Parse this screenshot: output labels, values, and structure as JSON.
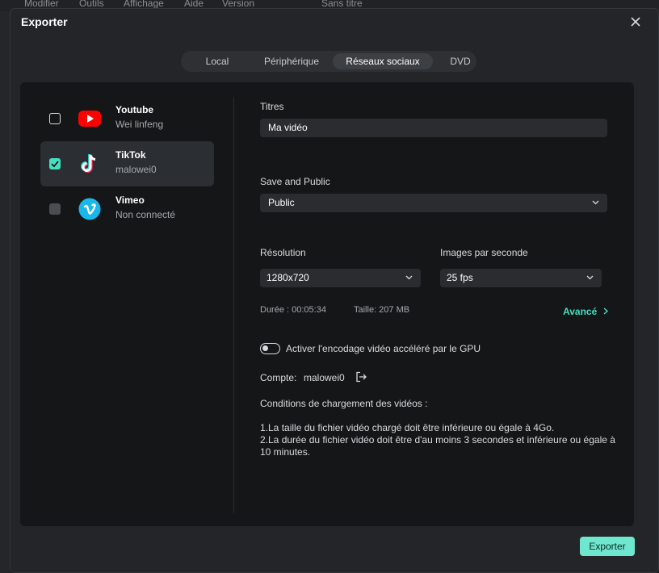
{
  "background_menu": [
    "Modifier",
    "Outils",
    "Affichage",
    "Aide",
    "Version",
    "Sans titre"
  ],
  "dialog": {
    "title": "Exporter"
  },
  "tabs": [
    {
      "label": "Local",
      "active": false
    },
    {
      "label": "Périphérique",
      "active": false
    },
    {
      "label": "Réseaux sociaux",
      "active": true
    },
    {
      "label": "DVD",
      "active": false
    }
  ],
  "accounts": [
    {
      "name": "Youtube",
      "subtitle": "Wei linfeng",
      "checked": false,
      "icon": "youtube-icon"
    },
    {
      "name": "TikTok",
      "subtitle": "malowei0",
      "checked": true,
      "icon": "tiktok-icon"
    },
    {
      "name": "Vimeo",
      "subtitle": "Non connecté",
      "checked": false,
      "icon": "vimeo-icon"
    }
  ],
  "form": {
    "title_label": "Titres",
    "title_value": "Ma vidéo",
    "privacy_label": "Save and Public",
    "privacy_value": "Public",
    "resolution_label": "Résolution",
    "resolution_value": "1280x720",
    "fps_label": "Images par seconde",
    "fps_value": "25 fps",
    "duration_text": "Durée : 00:05:34",
    "size_text": "Taille: 207 MB",
    "advanced_label": "Avancé",
    "gpu_label": "Activer l'encodage vidéo accéléré par le GPU",
    "gpu_enabled": false,
    "account_label": "Compte:",
    "account_value": "malowei0"
  },
  "conditions": {
    "heading": "Conditions de chargement des vidéos :",
    "line1": "1.La taille du fichier vidéo chargé doit être inférieure ou égale à 4Go.",
    "line2": "2.La durée du fichier vidéo doit être d'au moins 3 secondes et inférieure ou égale à 10 minutes."
  },
  "footer": {
    "export_label": "Exporter"
  },
  "colors": {
    "accent": "#43e0bf",
    "export_button": "#6fe7ce",
    "youtube": "#ff0000",
    "vimeo": "#1ab7ea"
  }
}
